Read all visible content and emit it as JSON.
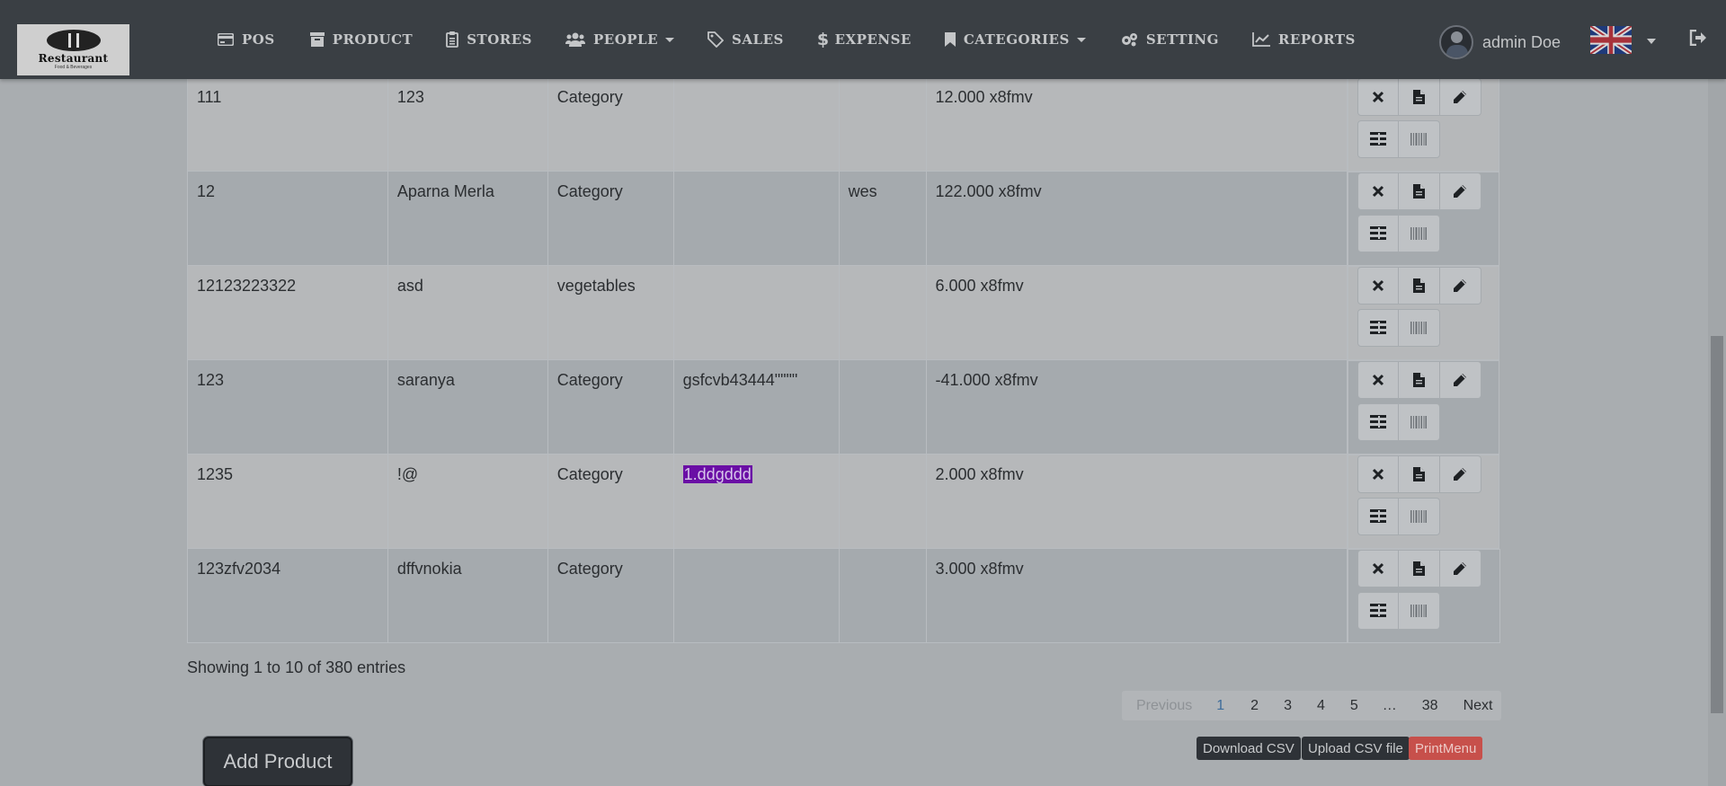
{
  "brand": {
    "logo_text": "Restaurant",
    "logo_sub": "Food & Beverages"
  },
  "nav": [
    {
      "label": "POS",
      "icon": "credit-card-icon"
    },
    {
      "label": "PRODUCT",
      "icon": "archive-icon"
    },
    {
      "label": "STORES",
      "icon": "clipboard-icon"
    },
    {
      "label": "PEOPLE",
      "icon": "users-icon",
      "dropdown": true
    },
    {
      "label": "SALES",
      "icon": "tag-icon"
    },
    {
      "label": "EXPENSE",
      "icon": "dollar-icon"
    },
    {
      "label": "CATEGORIES",
      "icon": "bookmark-icon",
      "dropdown": true
    },
    {
      "label": "SETTING",
      "icon": "gears-icon"
    },
    {
      "label": "REPORTS",
      "icon": "line-chart-icon"
    }
  ],
  "user": {
    "name": "admin Doe"
  },
  "table": {
    "rows": [
      {
        "code": "111",
        "name": "123",
        "category": "Category",
        "col4": "",
        "col5": "",
        "price": "12.000 x8fmv"
      },
      {
        "code": "12",
        "name": "Aparna Merla",
        "category": "Category",
        "col4": "",
        "col5": "wes",
        "price": "122.000 x8fmv"
      },
      {
        "code": "12123223322",
        "name": "asd",
        "category": "vegetables",
        "col4": "",
        "col5": "",
        "price": "6.000 x8fmv"
      },
      {
        "code": "123",
        "name": "saranya",
        "category": "Category",
        "col4": "gsfcvb43444\"\"\"\"",
        "col5": "",
        "price": "-41.000 x8fmv"
      },
      {
        "code": "1235",
        "name": "!@",
        "category": "Category",
        "col4": "1.ddgddd",
        "col5": "",
        "price": "2.000 x8fmv"
      },
      {
        "code": "123zfv2034",
        "name": "dffvnokia",
        "category": "Category",
        "col4": "",
        "col5": "",
        "price": "3.000 x8fmv"
      }
    ]
  },
  "info": "Showing 1 to 10 of 380 entries",
  "pagination": {
    "previous": "Previous",
    "pages": [
      "1",
      "2",
      "3",
      "4",
      "5",
      "…",
      "38"
    ],
    "next": "Next",
    "current": "1"
  },
  "buttons": {
    "add_product": "Add Product",
    "download_csv": "Download CSV",
    "upload_csv": "Upload CSV file",
    "print_menu": "PrintMenu"
  }
}
